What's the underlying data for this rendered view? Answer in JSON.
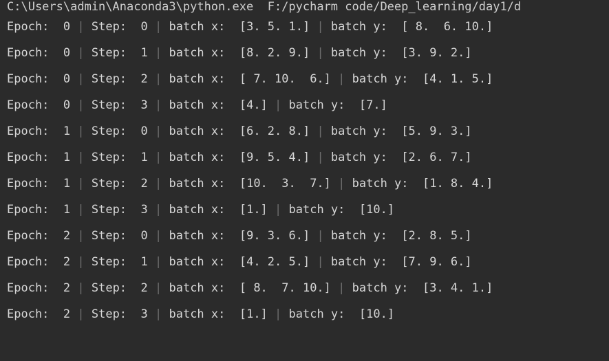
{
  "console": {
    "background_color": "#2b2b2b",
    "text_color": "#d6d6d6",
    "separator_color": "#6d6d6d",
    "command_line": "C:\\Users\\admin\\Anaconda3\\python.exe  F:/pycharm code/Deep_learning/day1/d",
    "separator": "|",
    "labels": {
      "epoch": "Epoch: ",
      "step": "Step: ",
      "batch_x": "batch x: ",
      "batch_y": "batch y: "
    },
    "rows": [
      {
        "epoch": " 0",
        "step": " 0",
        "batch_x": " [3. 5. 1.]",
        "batch_y": " [ 8.  6. 10.]"
      },
      {
        "epoch": " 0",
        "step": " 1",
        "batch_x": " [8. 2. 9.]",
        "batch_y": " [3. 9. 2.]"
      },
      {
        "epoch": " 0",
        "step": " 2",
        "batch_x": " [ 7. 10.  6.]",
        "batch_y": " [4. 1. 5.]"
      },
      {
        "epoch": " 0",
        "step": " 3",
        "batch_x": " [4.]",
        "batch_y": " [7.]"
      },
      {
        "epoch": " 1",
        "step": " 0",
        "batch_x": " [6. 2. 8.]",
        "batch_y": " [5. 9. 3.]"
      },
      {
        "epoch": " 1",
        "step": " 1",
        "batch_x": " [9. 5. 4.]",
        "batch_y": " [2. 6. 7.]"
      },
      {
        "epoch": " 1",
        "step": " 2",
        "batch_x": " [10.  3.  7.]",
        "batch_y": " [1. 8. 4.]"
      },
      {
        "epoch": " 1",
        "step": " 3",
        "batch_x": " [1.]",
        "batch_y": " [10.]"
      },
      {
        "epoch": " 2",
        "step": " 0",
        "batch_x": " [9. 3. 6.]",
        "batch_y": " [2. 8. 5.]"
      },
      {
        "epoch": " 2",
        "step": " 1",
        "batch_x": " [4. 2. 5.]",
        "batch_y": " [7. 9. 6.]"
      },
      {
        "epoch": " 2",
        "step": " 2",
        "batch_x": " [ 8.  7. 10.]",
        "batch_y": " [3. 4. 1.]"
      },
      {
        "epoch": " 2",
        "step": " 3",
        "batch_x": " [1.]",
        "batch_y": " [10.]"
      }
    ]
  }
}
